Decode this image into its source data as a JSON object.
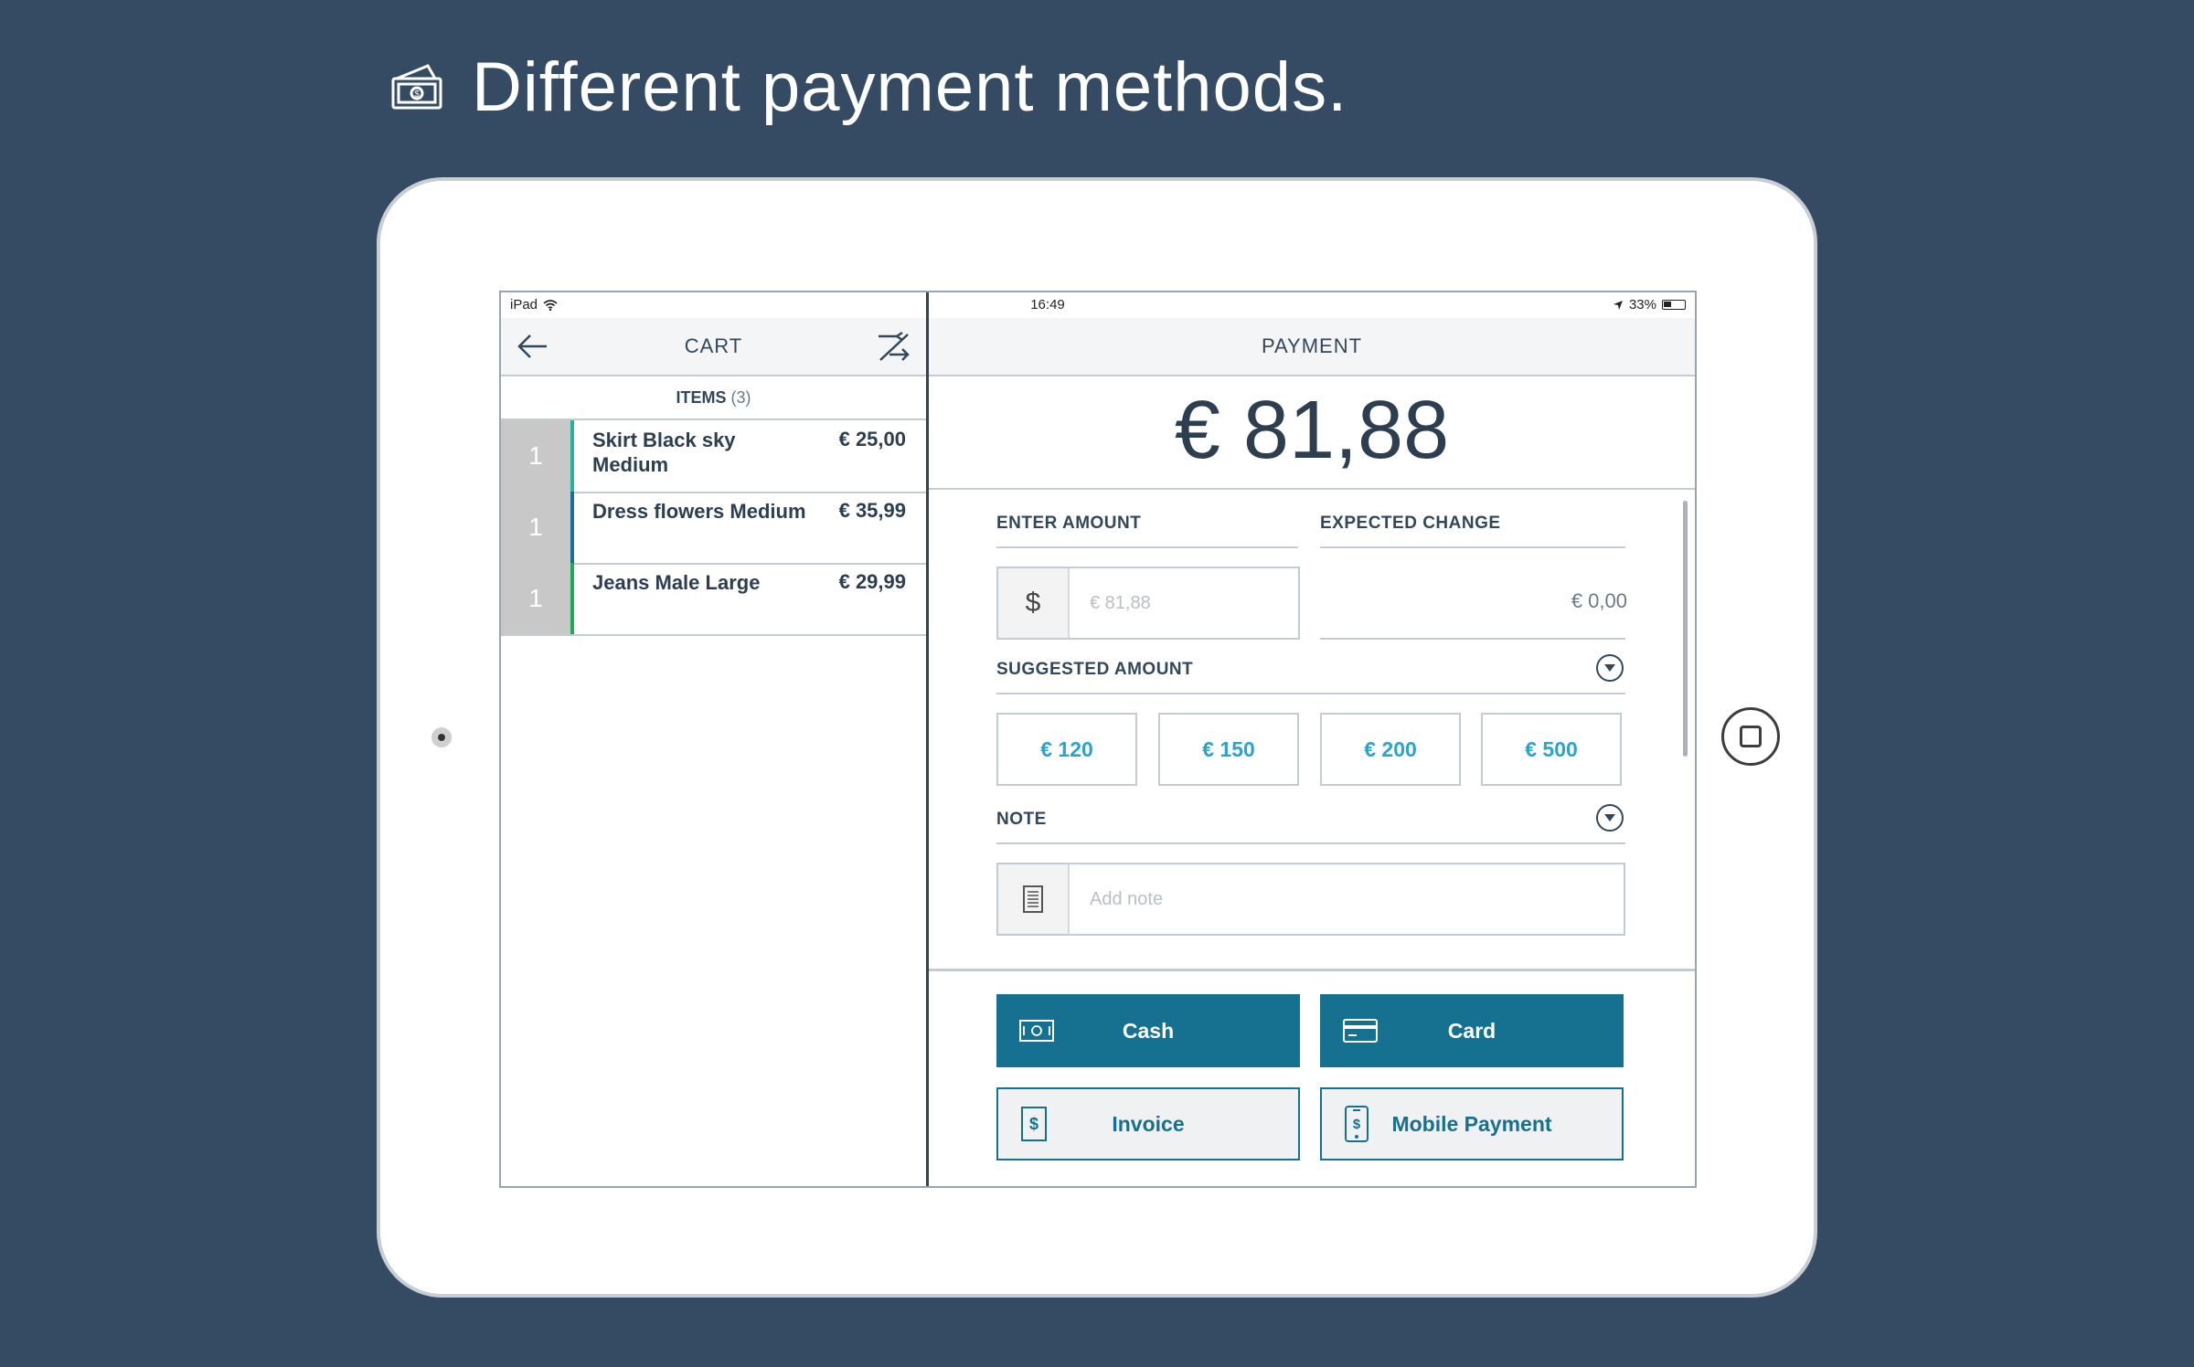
{
  "headline": {
    "text": "Different payment methods."
  },
  "status_bar": {
    "device": "iPad",
    "time": "16:49",
    "battery": "33%"
  },
  "cart": {
    "title": "CART",
    "items_label": "ITEMS",
    "items_count": "(3)",
    "items": [
      {
        "qty": "1",
        "name": "Skirt Black sky Medium",
        "price": "€ 25,00",
        "stripe": "#27b39a"
      },
      {
        "qty": "1",
        "name": "Dress flowers Medium",
        "price": "€ 35,99",
        "stripe": "#1b6f96"
      },
      {
        "qty": "1",
        "name": "Jeans Male Large",
        "price": "€ 29,99",
        "stripe": "#22a85a"
      }
    ]
  },
  "payment": {
    "title": "PAYMENT",
    "total": "€ 81,88",
    "enter_amount_label": "ENTER AMOUNT",
    "currency_symbol": "$",
    "amount_placeholder": "€ 81,88",
    "expected_change_label": "EXPECTED CHANGE",
    "expected_change_value": "€ 0,00",
    "suggested_label": "SUGGESTED AMOUNT",
    "suggested": [
      "€ 120",
      "€ 150",
      "€ 200",
      "€ 500"
    ],
    "note_label": "NOTE",
    "note_placeholder": "Add note",
    "methods": {
      "cash": "Cash",
      "card": "Card",
      "invoice": "Invoice",
      "mobile": "Mobile Payment"
    }
  },
  "colors": {
    "background": "#354b64",
    "accent": "#16708f",
    "suggest_text": "#2ba4c9"
  }
}
